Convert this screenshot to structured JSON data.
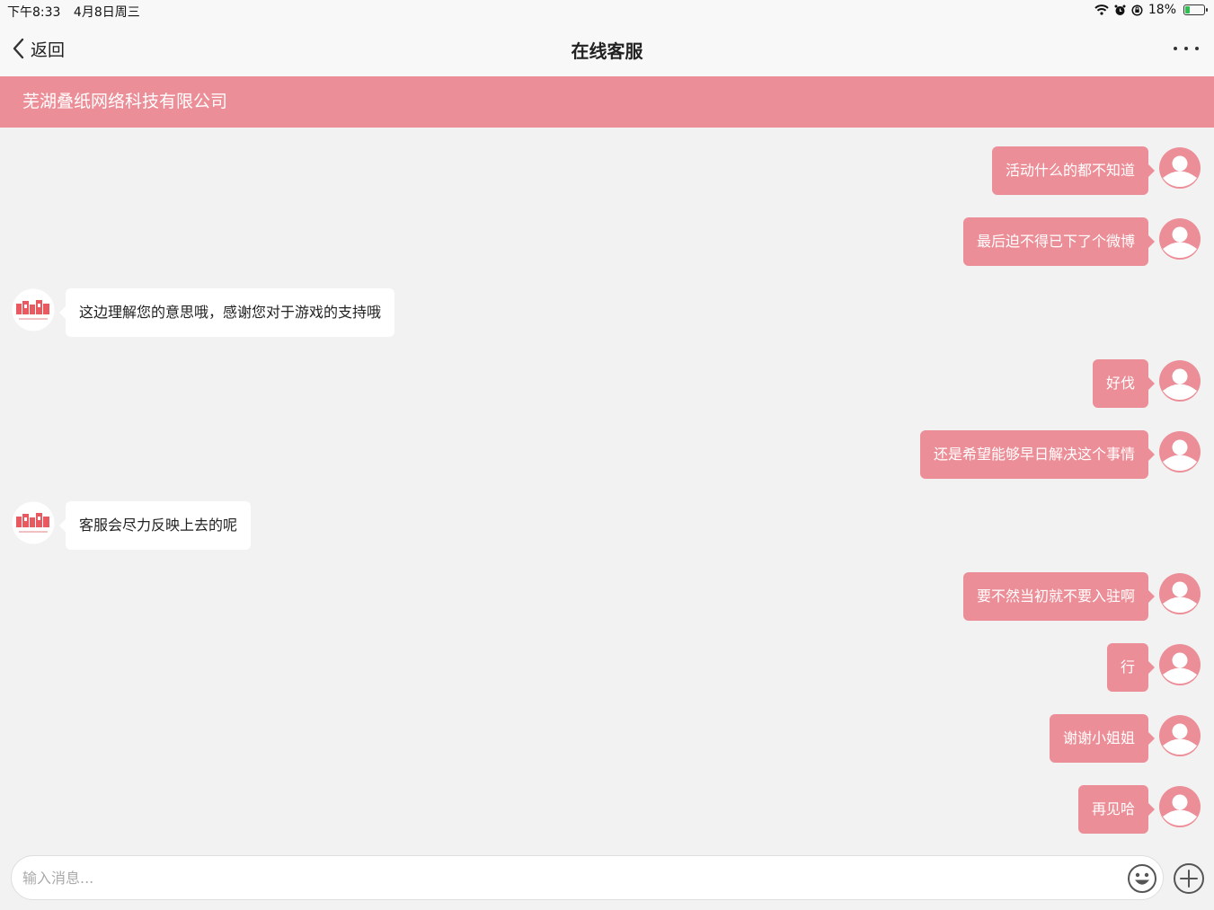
{
  "status_bar": {
    "time": "下午8:33",
    "date": "4月8日周三",
    "battery": "18%"
  },
  "nav": {
    "back_label": "返回",
    "title": "在线客服"
  },
  "banner": {
    "company": "芜湖叠纸网络科技有限公司"
  },
  "messages": [
    {
      "from": "user",
      "text": "活动什么的都不知道"
    },
    {
      "from": "user",
      "text": "最后迫不得已下了个微博"
    },
    {
      "from": "agent",
      "text": "这边理解您的意思哦，感谢您对于游戏的支持哦"
    },
    {
      "from": "user",
      "text": "好伐"
    },
    {
      "from": "user",
      "text": "还是希望能够早日解决这个事情"
    },
    {
      "from": "agent",
      "text": "客服会尽力反映上去的呢"
    },
    {
      "from": "user",
      "text": "要不然当初就不要入驻啊"
    },
    {
      "from": "user",
      "text": "行"
    },
    {
      "from": "user",
      "text": "谢谢小姐姐"
    },
    {
      "from": "user",
      "text": "再见哈"
    }
  ],
  "input": {
    "placeholder": "输入消息..."
  },
  "colors": {
    "accent": "#ec8e97",
    "background": "#f2f2f2",
    "bar": "#f8f8f8"
  }
}
